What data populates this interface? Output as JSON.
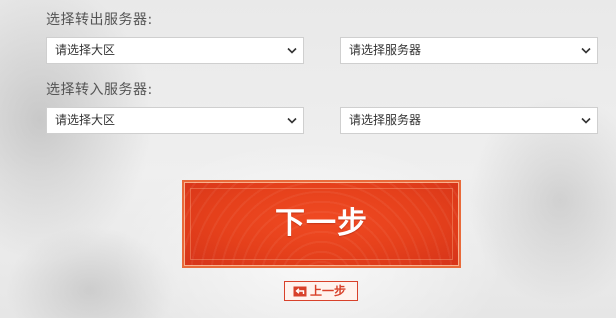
{
  "transfer_out": {
    "label": "选择转出服务器:",
    "region_select": {
      "value": "请选择大区"
    },
    "server_select": {
      "value": "请选择服务器"
    }
  },
  "transfer_in": {
    "label": "选择转入服务器:",
    "region_select": {
      "value": "请选择大区"
    },
    "server_select": {
      "value": "请选择服务器"
    }
  },
  "actions": {
    "next_label": "下一步",
    "back_label": "上一步"
  },
  "colors": {
    "accent": "#e5401b",
    "back_border": "#d8412a",
    "label_text": "#555555"
  },
  "icons": {
    "select_chevron": "chevron-down-icon",
    "back": "back-arrow-icon"
  }
}
